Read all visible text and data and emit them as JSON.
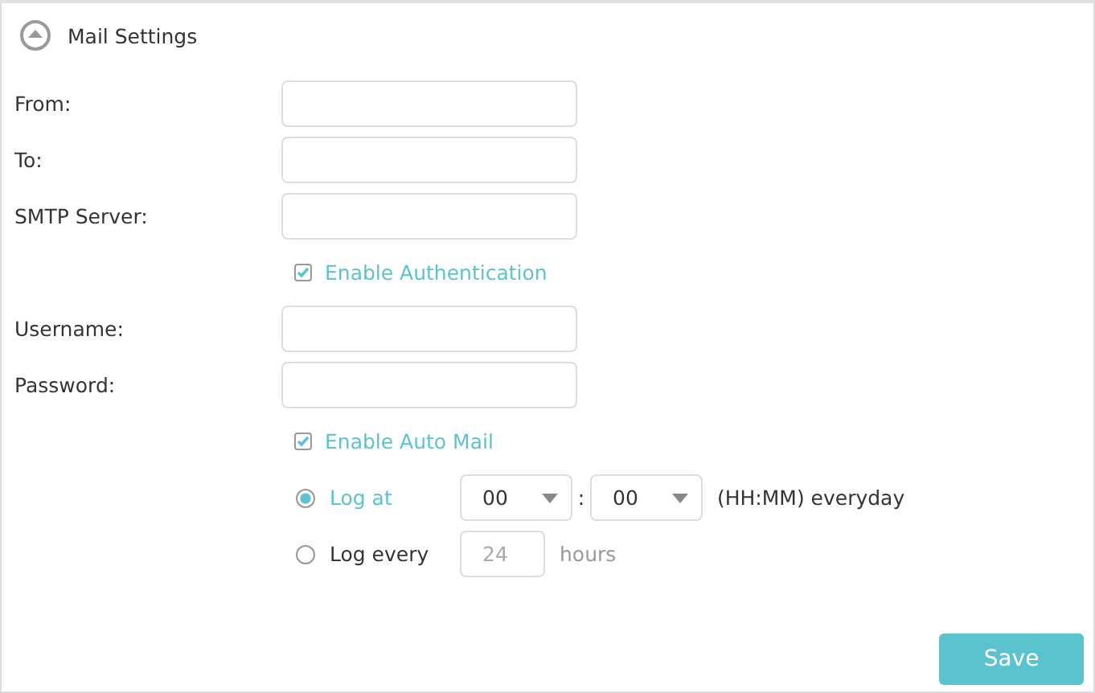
{
  "section": {
    "title": "Mail Settings",
    "expanded": true
  },
  "rows": [
    {
      "kind": "field",
      "label": "From:"
    },
    {
      "kind": "field",
      "label": "To:"
    },
    {
      "kind": "field",
      "label": "SMTP Server:"
    },
    {
      "kind": "checkbox",
      "label": "Enable Authentication",
      "checked": true
    },
    {
      "kind": "field",
      "label": "Username:"
    },
    {
      "kind": "field",
      "label": "Password:"
    },
    {
      "kind": "checkbox",
      "label": "Enable Auto Mail",
      "checked": true
    }
  ],
  "schedule": [
    {
      "kind": "time",
      "label": "Log at",
      "selected": true,
      "hour": "00",
      "separator": ":",
      "minute": "00",
      "suffix": "(HH:MM) everyday"
    },
    {
      "kind": "interval",
      "label": "Log every",
      "selected": false,
      "value": "24",
      "unit": "hours",
      "disabled": true
    }
  ],
  "buttons": [
    "Save"
  ]
}
